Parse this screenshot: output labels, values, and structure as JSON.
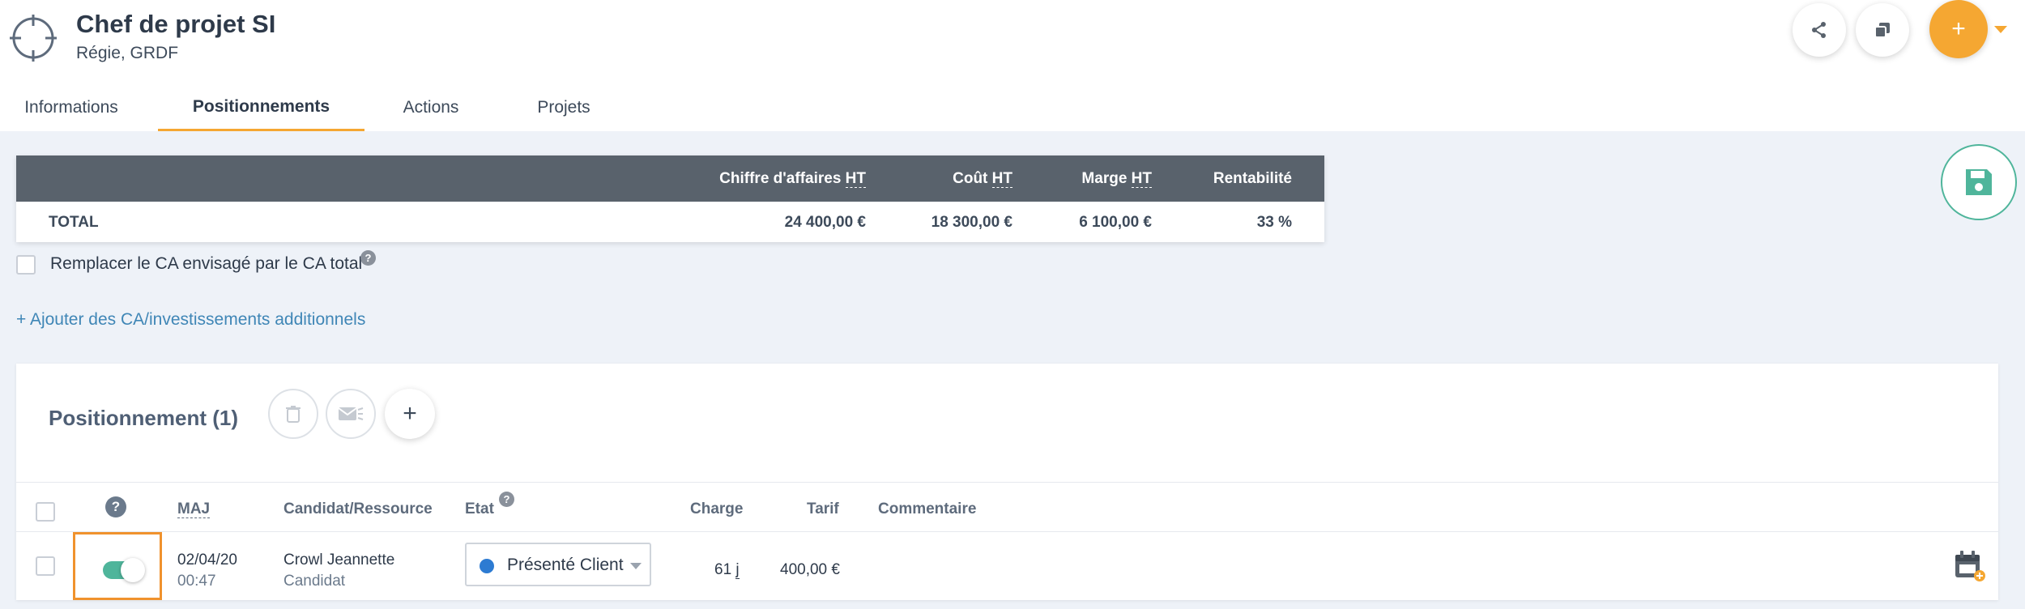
{
  "header": {
    "title": "Chef de projet SI",
    "subtitle": "Régie, GRDF",
    "add_label": "+"
  },
  "tabs": [
    {
      "label": "Informations",
      "active": false
    },
    {
      "label": "Positionnements",
      "active": true
    },
    {
      "label": "Actions",
      "active": false
    },
    {
      "label": "Projets",
      "active": false
    }
  ],
  "totals": {
    "headers": {
      "ca": "Chiffre d'affaires",
      "cout": "Coût",
      "marge": "Marge",
      "ht": "HT",
      "rentabilite": "Rentabilité"
    },
    "row": {
      "label": "TOTAL",
      "ca": "24 400,00 €",
      "cout": "18 300,00 €",
      "marge": "6 100,00 €",
      "rentabilite": "33 %"
    }
  },
  "replace_checkbox": {
    "label": "Remplacer le CA envisagé par le CA total",
    "checked": false
  },
  "help_glyph": "?",
  "add_link": "+ Ajouter des CA/investissements additionnels",
  "panel": {
    "title": "Positionnement (1)",
    "plus_label": "+",
    "columns": {
      "maj": "MAJ",
      "candidat": "Candidat/Ressource",
      "etat": "Etat",
      "charge": "Charge",
      "tarif": "Tarif",
      "commentaire": "Commentaire"
    },
    "rows": [
      {
        "date": "02/04/20",
        "time": "00:47",
        "name": "Crowl Jeannette",
        "role": "Candidat",
        "etat": "Présenté Client",
        "charge_value": "61",
        "charge_unit": "j",
        "tarif": "400,00 €",
        "commentaire": "",
        "active": true
      }
    ]
  },
  "colors": {
    "accent": "#f5a732",
    "green": "#4fb59b",
    "status_blue": "#2d7bd2",
    "table_header": "#59626c"
  },
  "icons": [
    "target-icon",
    "share-icon",
    "copy-icon",
    "save-icon",
    "trash-icon",
    "mail-icon",
    "calendar-edit-icon",
    "help-icon"
  ]
}
